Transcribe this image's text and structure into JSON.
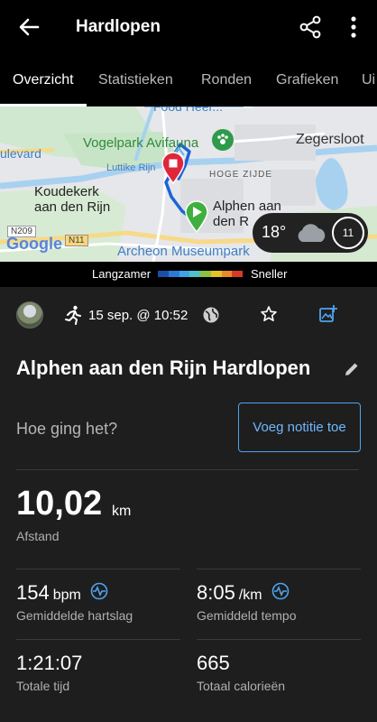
{
  "header": {
    "title": "Hardlopen",
    "back_icon": "arrow-left-icon",
    "share_icon": "share-icon",
    "more_icon": "more-vertical-icon"
  },
  "tabs": [
    {
      "label": "Overzicht",
      "active": true
    },
    {
      "label": "Statistieken",
      "active": false
    },
    {
      "label": "Ronden",
      "active": false
    },
    {
      "label": "Grafieken",
      "active": false
    },
    {
      "label": "Ui",
      "active": false
    }
  ],
  "map": {
    "labels": {
      "vogelpark": "Vogelpark Avifauna",
      "luttike": "Luttike Rijn",
      "zegersloot": "Zegersloot",
      "hoge_zijde": "HOGE ZIJDE",
      "koudekerk_1": "Koudekerk",
      "koudekerk_2": "aan den Rijn",
      "alphen_1": "Alphen aan",
      "alphen_2": "den R",
      "archeon": "Archeon Museumpark",
      "evard": "ulevard",
      "road_n209": "N209",
      "road_n11": "N11",
      "google": "Google"
    },
    "weather": {
      "temperature": "18°",
      "wind_speed": "11"
    }
  },
  "pace_legend": {
    "slower": "Langzamer",
    "faster": "Sneller",
    "colors": [
      "#1a4fa8",
      "#2b7bd6",
      "#3fa3e6",
      "#4fc2c9",
      "#8cc43f",
      "#e6c12a",
      "#e8892a",
      "#d83a2a"
    ]
  },
  "activity": {
    "date": "15 sep. @ 10:52",
    "title": "Alphen aan den Rijn Hardlopen",
    "feel_prompt": "Hoe ging het?",
    "add_note_label": "Voeg notitie toe"
  },
  "distance": {
    "value": "10,02",
    "unit": "km",
    "label": "Afstand"
  },
  "stats": {
    "heart_rate": {
      "value": "154",
      "unit": "bpm",
      "label": "Gemiddelde hartslag"
    },
    "pace": {
      "value": "8:05",
      "unit": "/km",
      "label": "Gemiddeld tempo"
    },
    "time": {
      "value": "1:21:07",
      "label": "Totale tijd"
    },
    "calories": {
      "value": "665",
      "label": "Totaal calorieën"
    }
  },
  "colors": {
    "accent": "#4ea3f0",
    "background": "#1e1e1e",
    "bar": "#000000"
  }
}
